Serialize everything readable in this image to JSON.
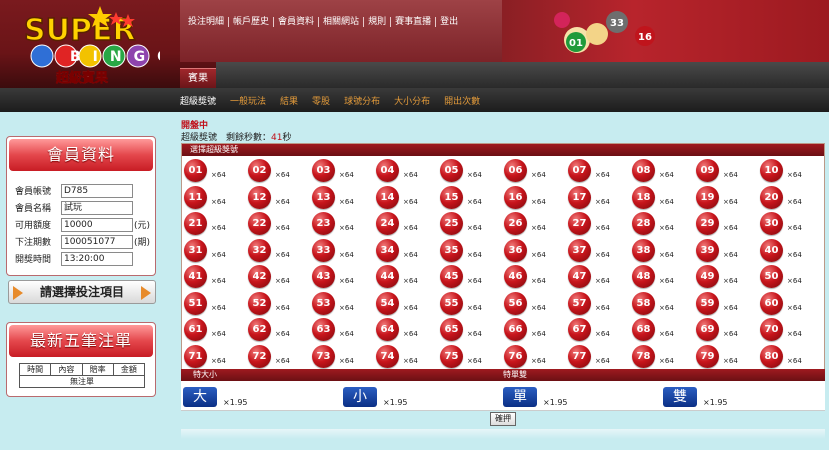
{
  "logo": {
    "super": "SUPER",
    "bingo": "BINGO",
    "chinese": "超級賓果"
  },
  "top_menu": [
    "投注明細",
    "帳戶歷史",
    "會員資料",
    "相關網站",
    "規則",
    "賽事直播",
    "登出"
  ],
  "deco_balls": [
    "01",
    "33",
    "16"
  ],
  "main_tab": "賓果",
  "sub_nav": [
    "超級獎號",
    "一般玩法",
    "結果",
    "零股",
    "球號分布",
    "大小分布",
    "開出次數"
  ],
  "member_panel": {
    "title": "會員資料",
    "rows": [
      {
        "label": "會員帳號",
        "value": "D785",
        "unit": ""
      },
      {
        "label": "會員名稱",
        "value": "試玩",
        "unit": ""
      },
      {
        "label": "可用額度",
        "value": "10000",
        "unit": "(元)"
      },
      {
        "label": "下注期數",
        "value": "100051077",
        "unit": "(期)"
      },
      {
        "label": "開獎時間",
        "value": "13:20:00",
        "unit": ""
      }
    ]
  },
  "choose_button": "請選擇投注項目",
  "latest_panel": {
    "title": "最新五筆注單",
    "headers": [
      "時間",
      "內容",
      "賠率",
      "金額"
    ],
    "empty": "無注單"
  },
  "status": "開盤中",
  "countdown": {
    "label": "超級獎號　剩餘秒數：",
    "seconds": "41",
    "unit": "秒"
  },
  "numbers_title": "選擇超級獎號",
  "number_odds": "×64",
  "numbers": [
    "01",
    "02",
    "03",
    "04",
    "05",
    "06",
    "07",
    "08",
    "09",
    "10",
    "11",
    "12",
    "13",
    "14",
    "15",
    "16",
    "17",
    "18",
    "19",
    "20",
    "21",
    "22",
    "23",
    "24",
    "25",
    "26",
    "27",
    "28",
    "29",
    "30",
    "31",
    "32",
    "33",
    "34",
    "35",
    "36",
    "37",
    "38",
    "39",
    "40",
    "41",
    "42",
    "43",
    "44",
    "45",
    "46",
    "47",
    "48",
    "49",
    "50",
    "51",
    "52",
    "53",
    "54",
    "55",
    "56",
    "57",
    "58",
    "59",
    "60",
    "61",
    "62",
    "63",
    "64",
    "65",
    "66",
    "67",
    "68",
    "69",
    "70",
    "71",
    "72",
    "73",
    "74",
    "75",
    "76",
    "77",
    "78",
    "79",
    "80"
  ],
  "big_small": {
    "title": "特大小",
    "big": "大",
    "small": "小",
    "odds": "×1.95"
  },
  "odd_even": {
    "title": "特單雙",
    "odd": "單",
    "even": "雙",
    "odds": "×1.95"
  },
  "submit": "確押",
  "colors": {
    "accent_red": "#c8151c",
    "header_dark": "#6a1417",
    "blue_button": "#0b2f85",
    "orange_link": "#e29a3a",
    "background": "#c7ecf0"
  }
}
